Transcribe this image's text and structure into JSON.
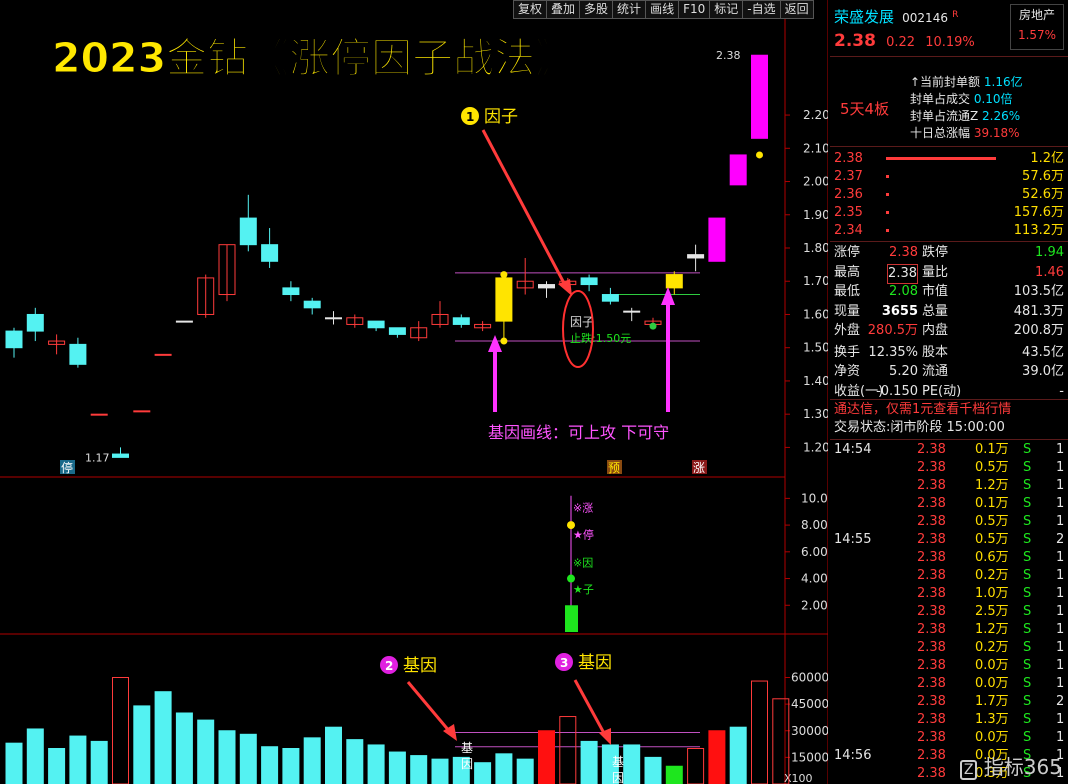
{
  "toolbar": {
    "items": [
      "复权",
      "叠加",
      "多股",
      "统计",
      "画线",
      "F10",
      "标记",
      "-自选",
      "返回"
    ]
  },
  "overlay": {
    "headline": "2023金钻《涨停因子战法》",
    "badge1_num": "1",
    "badge1_label": "因子",
    "badge2_num": "2",
    "badge2_label": "基因",
    "badge3_num": "3",
    "badge3_label": "基因",
    "gene_line_text": "基因画线：可上攻 下可守",
    "factor_tag": "因子",
    "stop_text": "止跌:1.50元",
    "low_label": "1.17",
    "high_label": "2.38",
    "tag_ting": "停",
    "tag_yu": "预",
    "tag_zhang": "涨",
    "ind_labels": [
      "※涨",
      "★停",
      "※因",
      "★子"
    ],
    "vol_tag1": "基因",
    "vol_tag2": "基因",
    "vol_unit": "X100"
  },
  "chart_data": [
    {
      "type": "candlestick",
      "title": "",
      "ylim": [
        1.12,
        2.48
      ],
      "yticks": [
        1.2,
        1.3,
        1.4,
        1.5,
        1.6,
        1.7,
        1.8,
        1.9,
        2.0,
        2.1,
        2.2
      ],
      "candles": [
        {
          "o": 1.5,
          "c": 1.55,
          "h": 1.56,
          "l": 1.47,
          "color": "cyan"
        },
        {
          "o": 1.55,
          "c": 1.6,
          "h": 1.62,
          "l": 1.52,
          "color": "cyan"
        },
        {
          "o": 1.51,
          "c": 1.52,
          "h": 1.54,
          "l": 1.48,
          "color": "red"
        },
        {
          "o": 1.51,
          "c": 1.45,
          "h": 1.53,
          "l": 1.44,
          "color": "cyan"
        },
        {
          "o": 1.3,
          "c": 1.3,
          "h": 1.3,
          "l": 1.3,
          "color": "red"
        },
        {
          "o": 1.18,
          "c": 1.17,
          "h": 1.2,
          "l": 1.17,
          "color": "cyan"
        },
        {
          "o": 1.31,
          "c": 1.31,
          "h": 1.31,
          "l": 1.31,
          "color": "red"
        },
        {
          "o": 1.48,
          "c": 1.48,
          "h": 1.48,
          "l": 1.48,
          "color": "red"
        },
        {
          "o": 1.58,
          "c": 1.58,
          "h": 1.58,
          "l": 1.58,
          "color": "white"
        },
        {
          "o": 1.6,
          "c": 1.71,
          "h": 1.72,
          "l": 1.59,
          "color": "red"
        },
        {
          "o": 1.66,
          "c": 1.81,
          "h": 1.81,
          "l": 1.64,
          "color": "red"
        },
        {
          "o": 1.89,
          "c": 1.81,
          "h": 1.96,
          "l": 1.79,
          "color": "cyan"
        },
        {
          "o": 1.81,
          "c": 1.76,
          "h": 1.86,
          "l": 1.74,
          "color": "cyan"
        },
        {
          "o": 1.68,
          "c": 1.66,
          "h": 1.7,
          "l": 1.64,
          "color": "cyan"
        },
        {
          "o": 1.64,
          "c": 1.62,
          "h": 1.65,
          "l": 1.6,
          "color": "cyan"
        },
        {
          "o": 1.59,
          "c": 1.59,
          "h": 1.61,
          "l": 1.57,
          "color": "white"
        },
        {
          "o": 1.57,
          "c": 1.59,
          "h": 1.6,
          "l": 1.56,
          "color": "red"
        },
        {
          "o": 1.58,
          "c": 1.56,
          "h": 1.58,
          "l": 1.55,
          "color": "cyan"
        },
        {
          "o": 1.56,
          "c": 1.54,
          "h": 1.56,
          "l": 1.53,
          "color": "cyan"
        },
        {
          "o": 1.53,
          "c": 1.56,
          "h": 1.58,
          "l": 1.52,
          "color": "red"
        },
        {
          "o": 1.57,
          "c": 1.6,
          "h": 1.64,
          "l": 1.56,
          "color": "red"
        },
        {
          "o": 1.59,
          "c": 1.57,
          "h": 1.6,
          "l": 1.56,
          "color": "cyan"
        },
        {
          "o": 1.56,
          "c": 1.57,
          "h": 1.58,
          "l": 1.55,
          "color": "red"
        },
        {
          "o": 1.58,
          "c": 1.71,
          "h": 1.72,
          "l": 1.52,
          "color": "yellow"
        },
        {
          "o": 1.68,
          "c": 1.7,
          "h": 1.77,
          "l": 1.66,
          "color": "red"
        },
        {
          "o": 1.69,
          "c": 1.68,
          "h": 1.7,
          "l": 1.65,
          "color": "white"
        },
        {
          "o": 1.69,
          "c": 1.7,
          "h": 1.71,
          "l": 1.68,
          "color": "red"
        },
        {
          "o": 1.71,
          "c": 1.69,
          "h": 1.72,
          "l": 1.67,
          "color": "cyan"
        },
        {
          "o": 1.66,
          "c": 1.64,
          "h": 1.68,
          "l": 1.63,
          "color": "cyan"
        },
        {
          "o": 1.61,
          "c": 1.61,
          "h": 1.62,
          "l": 1.58,
          "color": "white"
        },
        {
          "o": 1.57,
          "c": 1.58,
          "h": 1.59,
          "l": 1.57,
          "color": "red"
        },
        {
          "o": 1.68,
          "c": 1.72,
          "h": 1.73,
          "l": 1.66,
          "color": "yellow"
        },
        {
          "o": 1.77,
          "c": 1.78,
          "h": 1.81,
          "l": 1.73,
          "color": "white"
        },
        {
          "o": 1.76,
          "c": 1.89,
          "h": 1.89,
          "l": 1.76,
          "color": "magenta"
        },
        {
          "o": 1.99,
          "c": 2.08,
          "h": 2.08,
          "l": 1.99,
          "color": "magenta"
        },
        {
          "o": 2.13,
          "c": 2.38,
          "h": 2.38,
          "l": 2.13,
          "color": "magenta"
        }
      ],
      "hlines": [
        1.725,
        1.66,
        1.52
      ]
    },
    {
      "type": "bar",
      "title": "",
      "ylim": [
        0,
        11
      ],
      "yticks": [
        2,
        4,
        6,
        8,
        10
      ],
      "values": [
        2.0
      ],
      "markers": [
        8.0,
        4.0
      ]
    },
    {
      "type": "bar",
      "title": "",
      "xlabel": "X100",
      "ylim": [
        0,
        80000
      ],
      "yticks": [
        15000,
        30000,
        45000,
        60000
      ],
      "values": [
        23000,
        31000,
        20000,
        27000,
        24000,
        60000,
        44000,
        52000,
        40000,
        36000,
        30000,
        28000,
        21000,
        20000,
        26000,
        32000,
        25000,
        22000,
        18000,
        16000,
        14000,
        15000,
        12000,
        17000,
        14000,
        30000,
        38000,
        24000,
        22000,
        22000,
        15000,
        10000,
        20000,
        30000,
        32000,
        58000,
        48000
      ],
      "colors": [
        "cyan",
        "cyan",
        "cyan",
        "cyan",
        "cyan",
        "red",
        "cyan",
        "cyan",
        "cyan",
        "cyan",
        "cyan",
        "cyan",
        "cyan",
        "cyan",
        "cyan",
        "cyan",
        "cyan",
        "cyan",
        "cyan",
        "cyan",
        "cyan",
        "cyan",
        "cyan",
        "cyan",
        "cyan",
        "redfill",
        "red",
        "cyan",
        "cyan",
        "cyan",
        "cyan",
        "green",
        "red",
        "redfill",
        "cyan",
        "red",
        "red"
      ],
      "hlines": [
        29000,
        21000
      ]
    }
  ],
  "right": {
    "stock_name": "荣盛发展",
    "stock_code": "002146",
    "stock_flag": "R",
    "sector": "房地产",
    "sector_pct": "1.57%",
    "price": "2.38",
    "change": "0.22",
    "change_pct": "10.19%",
    "streak": "5天4板",
    "seal_lines": [
      {
        "label": "当前封单额",
        "value": "1.16亿"
      },
      {
        "label": "封单占成交",
        "value": "0.10倍"
      },
      {
        "label": "封单占流通Z",
        "value": "2.26%"
      },
      {
        "label": "十日总涨幅",
        "value": "39.18%"
      }
    ],
    "bids": [
      {
        "price": "2.38",
        "vol": "1.2亿"
      },
      {
        "price": "2.37",
        "vol": "57.6万"
      },
      {
        "price": "2.36",
        "vol": "52.6万"
      },
      {
        "price": "2.35",
        "vol": "157.6万"
      },
      {
        "price": "2.34",
        "vol": "113.2万"
      }
    ],
    "quote": [
      {
        "l1": "涨停",
        "v1": "2.38",
        "l2": "跌停",
        "v2": "1.94"
      },
      {
        "l1": "最高",
        "v1": "2.38",
        "l2": "量比",
        "v2": "1.46"
      },
      {
        "l1": "最低",
        "v1": "2.08",
        "l2": "市值",
        "v2": "103.5亿"
      },
      {
        "l1": "现量",
        "v1": "3655",
        "l2": "总量",
        "v2": "481.3万"
      },
      {
        "l1": "外盘",
        "v1": "280.5万",
        "l2": "内盘",
        "v2": "200.8万"
      },
      {
        "l1": "换手",
        "v1": "12.35%",
        "l2": "股本",
        "v2": "43.5亿"
      },
      {
        "l1": "净资",
        "v1": "5.20",
        "l2": "流通",
        "v2": "39.0亿"
      },
      {
        "l1": "收益(一)",
        "v1": "-0.150",
        "l2": "PE(动)",
        "v2": "-"
      }
    ],
    "promo": "通达信，仅需1元查看千档行情",
    "trade_status_label": "交易状态:",
    "trade_status": "闭市阶段 15:00:00",
    "ticks": [
      {
        "t": "14:54",
        "p": "2.38",
        "v": "0.1万",
        "s": "S",
        "n": "1"
      },
      {
        "t": "",
        "p": "2.38",
        "v": "0.5万",
        "s": "S",
        "n": "1"
      },
      {
        "t": "",
        "p": "2.38",
        "v": "1.2万",
        "s": "S",
        "n": "1"
      },
      {
        "t": "",
        "p": "2.38",
        "v": "0.1万",
        "s": "S",
        "n": "1"
      },
      {
        "t": "",
        "p": "2.38",
        "v": "0.5万",
        "s": "S",
        "n": "1"
      },
      {
        "t": "14:55",
        "p": "2.38",
        "v": "0.5万",
        "s": "S",
        "n": "2"
      },
      {
        "t": "",
        "p": "2.38",
        "v": "0.6万",
        "s": "S",
        "n": "1"
      },
      {
        "t": "",
        "p": "2.38",
        "v": "0.2万",
        "s": "S",
        "n": "1"
      },
      {
        "t": "",
        "p": "2.38",
        "v": "1.0万",
        "s": "S",
        "n": "1"
      },
      {
        "t": "",
        "p": "2.38",
        "v": "2.5万",
        "s": "S",
        "n": "1"
      },
      {
        "t": "",
        "p": "2.38",
        "v": "1.2万",
        "s": "S",
        "n": "1"
      },
      {
        "t": "",
        "p": "2.38",
        "v": "0.2万",
        "s": "S",
        "n": "1"
      },
      {
        "t": "",
        "p": "2.38",
        "v": "0.0万",
        "s": "S",
        "n": "1"
      },
      {
        "t": "",
        "p": "2.38",
        "v": "0.0万",
        "s": "S",
        "n": "1"
      },
      {
        "t": "",
        "p": "2.38",
        "v": "1.7万",
        "s": "S",
        "n": "2"
      },
      {
        "t": "",
        "p": "2.38",
        "v": "1.3万",
        "s": "S",
        "n": "1"
      },
      {
        "t": "",
        "p": "2.38",
        "v": "0.0万",
        "s": "S",
        "n": "1"
      },
      {
        "t": "14:56",
        "p": "2.38",
        "v": "0.0万",
        "s": "S",
        "n": "1"
      },
      {
        "t": "",
        "p": "2.38",
        "v": "0.3万",
        "s": "S",
        "n": "1"
      }
    ],
    "watermark": "指标365"
  }
}
